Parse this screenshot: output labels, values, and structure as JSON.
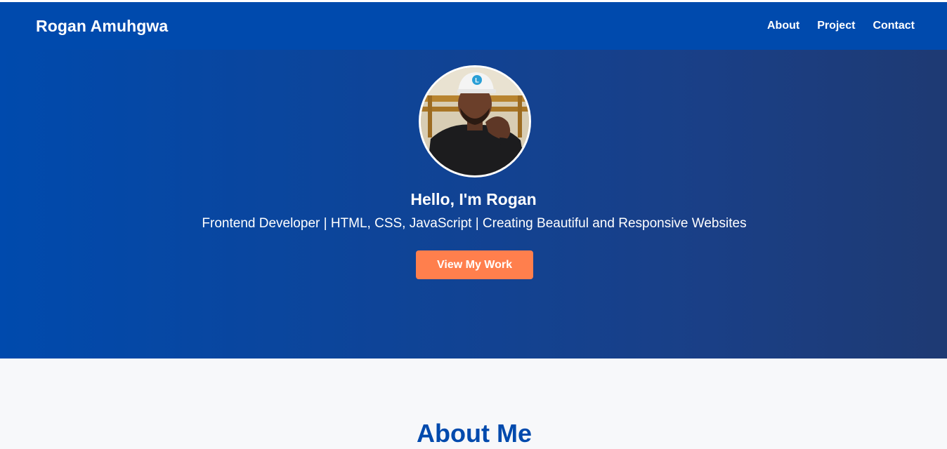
{
  "header": {
    "brand": "Rogan Amuhgwa",
    "nav": [
      {
        "label": "About"
      },
      {
        "label": "Project"
      },
      {
        "label": "Contact"
      }
    ]
  },
  "hero": {
    "title": "Hello, I'm Rogan",
    "subtitle": "Frontend Developer | HTML, CSS, JavaScript | Creating Beautiful and Responsive Websites",
    "cta_label": "View My Work",
    "avatar_icon": "profile-photo"
  },
  "about": {
    "heading": "About Me"
  },
  "colors": {
    "primary": "#004aad",
    "accent": "#ff7f4d",
    "section_bg": "#f7f8fa"
  }
}
